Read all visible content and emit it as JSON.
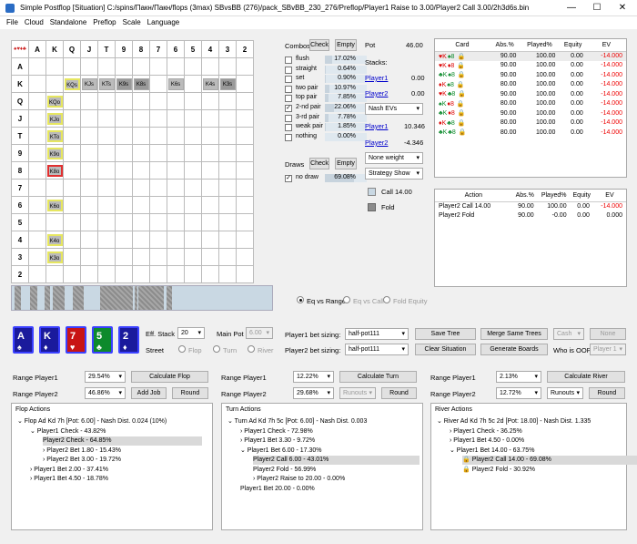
{
  "title": "Simple Postflop [Situation] C:/spins/Пакн/Пакн/flops (3max) SBvsBB (276)/pack_SBvBB_230_276/Preflop/Player1 Raise to 3.00/Player2 Call 3.00/2h3d6s.bin",
  "window": {
    "min": "—",
    "max": "☐",
    "close": "✕"
  },
  "menu": [
    "File",
    "Cloud",
    "Standalone",
    "Preflop",
    "Scale",
    "Language"
  ],
  "grid": {
    "corner": "♠♥♦♣",
    "ranks": [
      "A",
      "K",
      "Q",
      "J",
      "T",
      "9",
      "8",
      "7",
      "6",
      "5",
      "4",
      "3",
      "2"
    ],
    "cells": [
      {
        "r": 1,
        "c": 2,
        "t": "KQs",
        "cls": "y"
      },
      {
        "r": 1,
        "c": 3,
        "t": "KJs",
        "cls": ""
      },
      {
        "r": 1,
        "c": 4,
        "t": "KTs",
        "cls": ""
      },
      {
        "r": 1,
        "c": 5,
        "t": "K9s",
        "cls": "sel"
      },
      {
        "r": 1,
        "c": 6,
        "t": "K8s",
        "cls": "sel"
      },
      {
        "r": 1,
        "c": 8,
        "t": "K6s",
        "cls": ""
      },
      {
        "r": 1,
        "c": 10,
        "t": "K4s",
        "cls": ""
      },
      {
        "r": 1,
        "c": 11,
        "t": "K3s",
        "cls": "sel"
      },
      {
        "r": 2,
        "c": 1,
        "t": "KQo",
        "cls": "y"
      },
      {
        "r": 3,
        "c": 1,
        "t": "KJo",
        "cls": "y"
      },
      {
        "r": 4,
        "c": 1,
        "t": "KTo",
        "cls": "y"
      },
      {
        "r": 5,
        "c": 1,
        "t": "K9o",
        "cls": "y"
      },
      {
        "r": 6,
        "c": 1,
        "t": "K8o",
        "cls": "r"
      },
      {
        "r": 8,
        "c": 1,
        "t": "K6o",
        "cls": "y"
      },
      {
        "r": 10,
        "c": 1,
        "t": "K4o",
        "cls": "y"
      },
      {
        "r": 11,
        "c": 1,
        "t": "K3o",
        "cls": "y"
      }
    ]
  },
  "combos": {
    "label": "Combos",
    "check": "Check",
    "empty": "Empty",
    "items": [
      {
        "name": "flush",
        "val": "17.02%",
        "pct": 17.02,
        "on": false
      },
      {
        "name": "straight",
        "val": "0.64%",
        "pct": 0.64,
        "on": false
      },
      {
        "name": "set",
        "val": "0.90%",
        "pct": 0.9,
        "on": false
      },
      {
        "name": "two pair",
        "val": "10.97%",
        "pct": 10.97,
        "on": false
      },
      {
        "name": "top pair",
        "val": "7.85%",
        "pct": 7.85,
        "on": false
      },
      {
        "name": "2-nd pair",
        "val": "22.06%",
        "pct": 22.06,
        "on": true
      },
      {
        "name": "3-rd pair",
        "val": "7.78%",
        "pct": 7.78,
        "on": false
      },
      {
        "name": "weak pair",
        "val": "1.85%",
        "pct": 1.85,
        "on": false
      },
      {
        "name": "nothing",
        "val": "0.00%",
        "pct": 0,
        "on": false
      }
    ]
  },
  "draws": {
    "label": "Draws",
    "check": "Check",
    "empty": "Empty",
    "items": [
      {
        "name": "no draw",
        "val": "69.08%",
        "pct": 69.08,
        "on": true
      }
    ]
  },
  "pot": {
    "label": "Pot",
    "value": "46.00",
    "stacks": "Stacks:",
    "p1": "Player1",
    "p1v": "0.00",
    "p2": "Player2",
    "p2v": "0.00",
    "nash": "Nash EVs",
    "e1": "Player1",
    "e1v": "10.346",
    "e2": "Player2",
    "e2v": "-4.346",
    "weight": "None weight",
    "strategy": "Strategy Show",
    "call": "Call 14.00",
    "fold": "Fold"
  },
  "card_table": {
    "headers": [
      "Card",
      "Abs.%",
      "Played%",
      "Equity",
      "EV"
    ],
    "rows": [
      {
        "c": "♥K ♠8",
        "a": "90.00",
        "p": "100.00",
        "e": "0.00",
        "ev": "-14.000"
      },
      {
        "c": "♥K ♦8",
        "a": "90.00",
        "p": "100.00",
        "e": "0.00",
        "ev": "-14.000"
      },
      {
        "c": "♣K ♠8",
        "a": "90.00",
        "p": "100.00",
        "e": "0.00",
        "ev": "-14.000"
      },
      {
        "c": "♦K ♠8",
        "a": "80.00",
        "p": "100.00",
        "e": "0.00",
        "ev": "-14.000"
      },
      {
        "c": "♥K ♣8",
        "a": "90.00",
        "p": "100.00",
        "e": "0.00",
        "ev": "-14.000"
      },
      {
        "c": "♠K ♦8",
        "a": "80.00",
        "p": "100.00",
        "e": "0.00",
        "ev": "-14.000"
      },
      {
        "c": "♣K ♦8",
        "a": "90.00",
        "p": "100.00",
        "e": "0.00",
        "ev": "-14.000"
      },
      {
        "c": "♦K ♣8",
        "a": "80.00",
        "p": "100.00",
        "e": "0.00",
        "ev": "-14.000"
      },
      {
        "c": "♣K ♣8",
        "a": "80.00",
        "p": "100.00",
        "e": "0.00",
        "ev": "-14.000"
      }
    ]
  },
  "action_table": {
    "headers": [
      "Action",
      "Abs.%",
      "Played%",
      "Equity",
      "EV"
    ],
    "rows": [
      {
        "c": "Player2 Call 14.00",
        "a": "90.00",
        "p": "100.00",
        "e": "0.00",
        "ev": "-14.000"
      },
      {
        "c": "Player2 Fold",
        "a": "90.00",
        "p": "-0.00",
        "e": "0.00",
        "ev": "0.000"
      }
    ]
  },
  "radio_eq": [
    "Eq vs Range",
    "Eq vs Call",
    "Fold Equity"
  ],
  "board": [
    {
      "r": "A",
      "s": "♠",
      "bg": "#1a1a9c"
    },
    {
      "r": "K",
      "s": "♦",
      "bg": "#1a1a9c"
    },
    {
      "r": "7",
      "s": "♥",
      "bg": "#c81414"
    },
    {
      "r": "5",
      "s": "♣",
      "bg": "#0d8a2c"
    },
    {
      "r": "2",
      "s": "♦",
      "bg": "#1a1a9c"
    }
  ],
  "eff": {
    "label": "Eff. Stack",
    "val": "20",
    "mainpot": "Main Pot",
    "mpval": "6.00",
    "street": "Street",
    "flop": "Flop",
    "turn": "Turn",
    "river": "River"
  },
  "sizing": {
    "p1": "Player1 bet sizing:",
    "p1v": "half-pot111",
    "p2": "Player2 bet sizing:",
    "p2v": "half-pot111",
    "save": "Save Tree",
    "merge": "Merge Same Trees",
    "cash": "Cash",
    "none": "None",
    "clear": "Clear Situation",
    "gen": "Generate Boards",
    "oop": "Who is OOP:",
    "oopv": "Player 1"
  },
  "ranges": {
    "flop": {
      "p1": "Range Player1",
      "p1v": "29.54%",
      "p2": "Range Player2",
      "p2v": "46.86%",
      "btn": "Calculate Flop",
      "add": "Add Job",
      "round": "Round"
    },
    "turn": {
      "p1": "Range Player1",
      "p1v": "12.22%",
      "p2": "Range Player2",
      "p2v": "29.68%",
      "btn": "Calculate Turn",
      "runouts": "Runouts",
      "round": "Round"
    },
    "river": {
      "p1": "Range Player1",
      "p1v": "2.13%",
      "p2": "Range Player2",
      "p2v": "12.72%",
      "btn": "Calculate River",
      "runouts": "Runouts",
      "round": "Round"
    }
  },
  "flop_tree": {
    "title": "Flop Actions",
    "rows": [
      {
        "t": "⌄ Flop Ad Kd 7h [Pot: 6.00] - Nash Dist. 0.024 (10%)",
        "i": 0
      },
      {
        "t": "⌄ Player1 Check - 43.82%",
        "i": 1
      },
      {
        "t": "Player2 Check - 64.85%",
        "i": 2,
        "hl": true
      },
      {
        "t": "› Player2 Bet 1.80 - 15.43%",
        "i": 2
      },
      {
        "t": "› Player2 Bet 3.00 - 19.72%",
        "i": 2
      },
      {
        "t": "› Player1 Bet 2.00 - 37.41%",
        "i": 1
      },
      {
        "t": "› Player1 Bet 4.50 - 18.78%",
        "i": 1
      }
    ]
  },
  "turn_tree": {
    "title": "Turn Actions",
    "rows": [
      {
        "t": "⌄ Turn Ad Kd 7h 5c [Pot: 6.00] - Nash Dist. 0.003",
        "i": 0
      },
      {
        "t": "› Player1 Check - 72.98%",
        "i": 1
      },
      {
        "t": "› Player1 Bet 3.30 - 9.72%",
        "i": 1
      },
      {
        "t": "⌄ Player1 Bet 6.00 - 17.30%",
        "i": 1
      },
      {
        "t": "Player2 Call 6.00 - 43.01%",
        "i": 2,
        "hl": true
      },
      {
        "t": "Player2 Fold - 56.99%",
        "i": 2
      },
      {
        "t": "› Player2 Raise to 20.00 - 0.00%",
        "i": 2
      },
      {
        "t": "Player1 Bet 20.00 - 0.00%",
        "i": 1
      }
    ]
  },
  "river_tree": {
    "title": "River Actions",
    "rows": [
      {
        "t": "⌄ River Ad Kd 7h 5c 2d [Pot: 18.00] - Nash Dist. 1.335",
        "i": 0
      },
      {
        "t": "› Player1 Check - 36.25%",
        "i": 1
      },
      {
        "t": "› Player1 Bet 4.50 - 0.00%",
        "i": 1
      },
      {
        "t": "⌄ Player1 Bet 14.00 - 63.75%",
        "i": 1
      },
      {
        "t": "Player2 Call 14.00 - 69.08%",
        "i": 2,
        "hl": true
      },
      {
        "t": "Player2 Fold - 30.92%",
        "i": 2
      }
    ]
  }
}
